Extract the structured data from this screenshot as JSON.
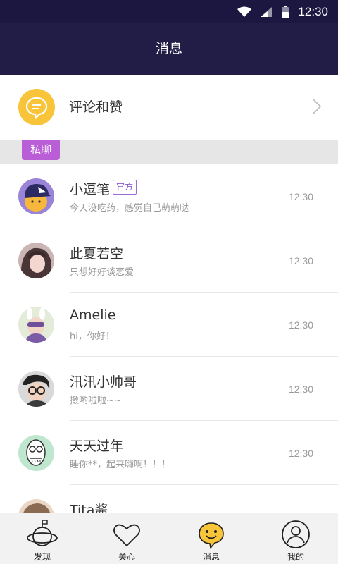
{
  "status_bar": {
    "time": "12:30",
    "icons": [
      "wifi-icon",
      "signal-icon",
      "battery-icon"
    ]
  },
  "nav": {
    "title": "消息"
  },
  "comments_entry": {
    "label": "评论和赞",
    "icon": "comment-bubble-icon"
  },
  "section": {
    "tag": "私聊"
  },
  "messages": [
    {
      "name": "小逗笔",
      "badge": "官方",
      "preview": "今天没吃药，感觉自己萌萌哒",
      "time": "12:30"
    },
    {
      "name": "此夏若空",
      "preview": "只想好好谈恋爱",
      "time": "12:30"
    },
    {
      "name": "Amelie",
      "preview": "hi，你好！",
      "time": "12:30"
    },
    {
      "name": "汛汛小帅哥",
      "preview": "撒哟啦啦~~",
      "time": "12:30"
    },
    {
      "name": "天天过年",
      "preview": "睡你**，起来嗨啊！！！",
      "time": "12:30"
    },
    {
      "name": "Tita酱",
      "preview": "",
      "time": ""
    }
  ],
  "tabs": [
    {
      "label": "发现",
      "icon": "planet-icon"
    },
    {
      "label": "关心",
      "icon": "heart-icon"
    },
    {
      "label": "消息",
      "icon": "smiley-bubble-icon",
      "active": true
    },
    {
      "label": "我的",
      "icon": "user-icon"
    }
  ],
  "colors": {
    "header": "#221d47",
    "accent": "#f8c53a",
    "tag": "#b95ed6"
  }
}
